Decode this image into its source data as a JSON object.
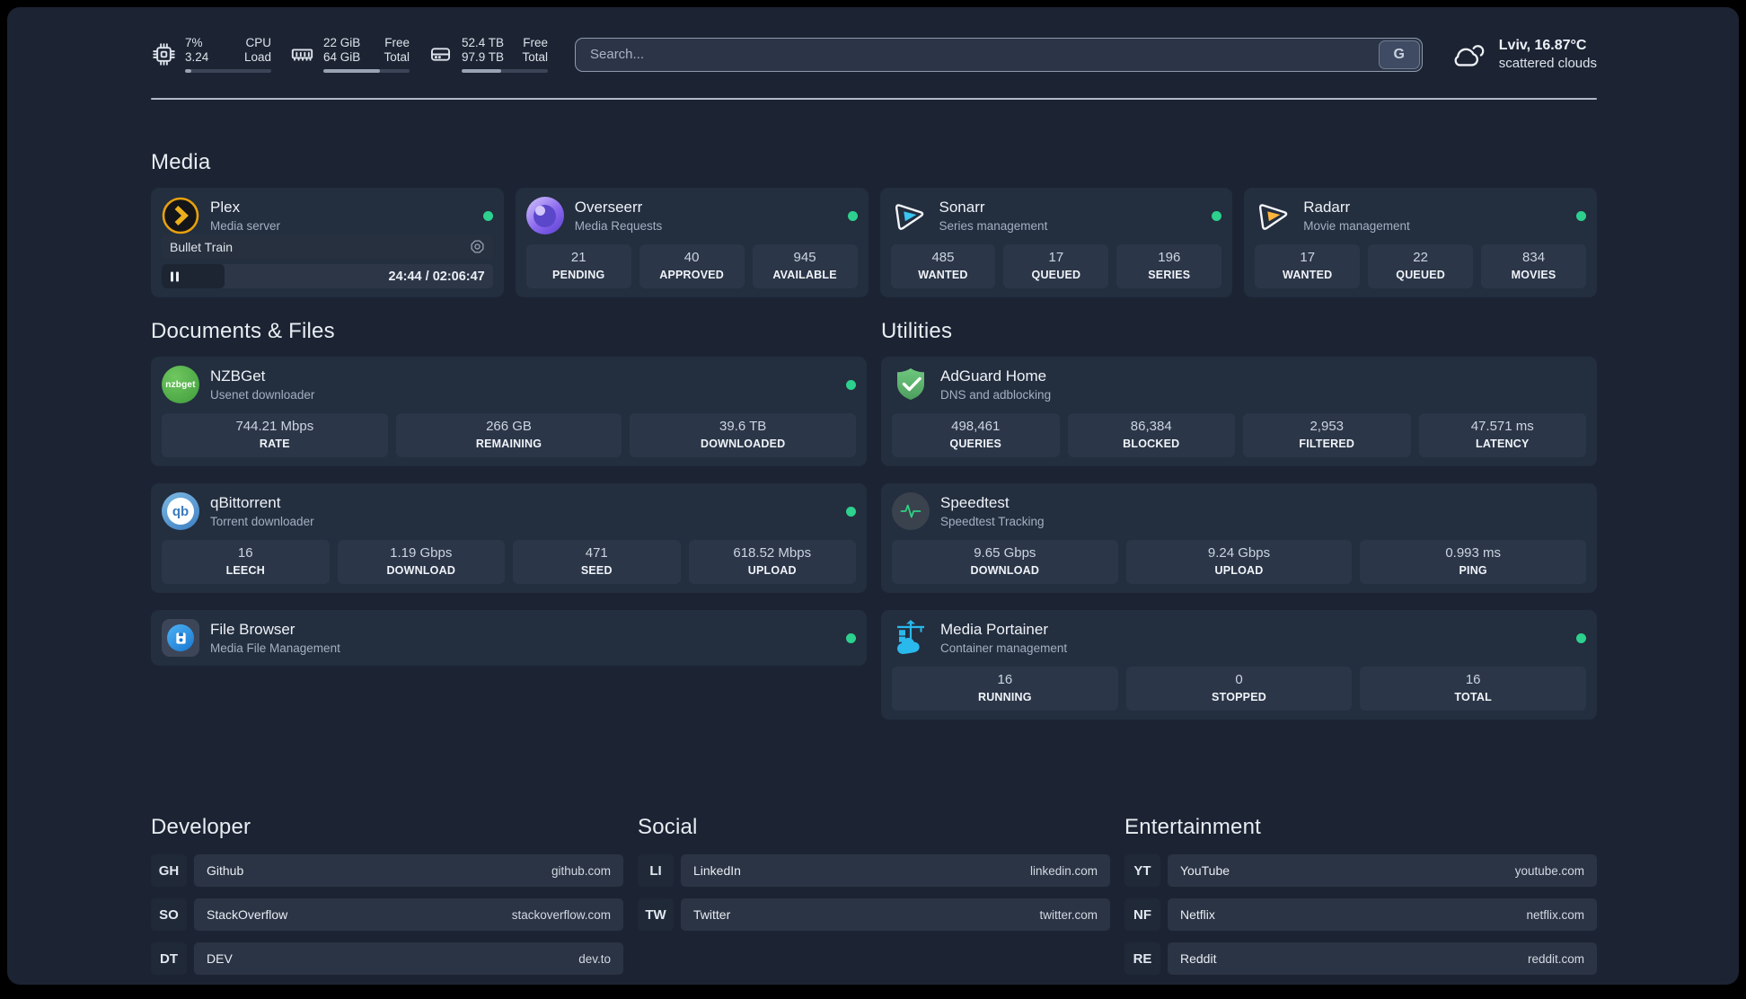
{
  "colors": {
    "page-bg": "#1c2433",
    "card-bg": "#232e3f",
    "tile-bg": "#2b3648",
    "green": "#2dd08d",
    "text": "#e8ecf2",
    "text-dim": "#a4b0c1",
    "divider": "#c2cbd6",
    "plex-orange": "#e7a00d",
    "overseerr-purple": "#8a68ee",
    "sonarr-blue": "#38c6f4",
    "radarr-orange": "#ffb53c",
    "nzbget-green": "#4caf50",
    "qbittorrent-blue": "#3d7fc4",
    "adguard-green": "#5fb86e",
    "speedtest-pulse": "#2ed184",
    "filebrowser-blue": "#2196f3",
    "portainer-blue": "#2ab9ec"
  },
  "header": {
    "resources": [
      {
        "icon": "cpu-icon",
        "values": [
          "7%",
          "3.24"
        ],
        "labels": [
          "CPU",
          "Load"
        ],
        "bar_pct": 7
      },
      {
        "icon": "memory-icon",
        "values": [
          "22 GiB",
          "64 GiB"
        ],
        "labels": [
          "Free",
          "Total"
        ],
        "bar_pct": 66
      },
      {
        "icon": "disk-icon",
        "values": [
          "52.4 TB",
          "97.9 TB"
        ],
        "labels": [
          "Free",
          "Total"
        ],
        "bar_pct": 46
      }
    ],
    "search": {
      "placeholder": "Search...",
      "provider_button": "G"
    },
    "weather": {
      "icon": "scattered-clouds-icon",
      "headline": "Lviv, 16.87°C",
      "condition": "scattered clouds"
    }
  },
  "media": {
    "title": "Media",
    "plex": {
      "name": "Plex",
      "description": "Media server",
      "online": true,
      "now_playing": "Bullet Train",
      "time_display": "24:44 / 02:06:47",
      "progress_pct": 19
    },
    "overseerr": {
      "name": "Overseerr",
      "description": "Media Requests",
      "online": true,
      "stats": [
        {
          "value": "21",
          "label": "PENDING"
        },
        {
          "value": "40",
          "label": "APPROVED"
        },
        {
          "value": "945",
          "label": "AVAILABLE"
        }
      ]
    },
    "sonarr": {
      "name": "Sonarr",
      "description": "Series management",
      "online": true,
      "stats": [
        {
          "value": "485",
          "label": "WANTED"
        },
        {
          "value": "17",
          "label": "QUEUED"
        },
        {
          "value": "196",
          "label": "SERIES"
        }
      ]
    },
    "radarr": {
      "name": "Radarr",
      "description": "Movie management",
      "online": true,
      "stats": [
        {
          "value": "17",
          "label": "WANTED"
        },
        {
          "value": "22",
          "label": "QUEUED"
        },
        {
          "value": "834",
          "label": "MOVIES"
        }
      ]
    }
  },
  "documents": {
    "title": "Documents & Files",
    "nzbget": {
      "name": "NZBGet",
      "description": "Usenet downloader",
      "online": true,
      "icon_text": "nzbget",
      "stats": [
        {
          "value": "744.21 Mbps",
          "label": "RATE"
        },
        {
          "value": "266 GB",
          "label": "REMAINING"
        },
        {
          "value": "39.6 TB",
          "label": "DOWNLOADED"
        }
      ]
    },
    "qbittorrent": {
      "name": "qBittorrent",
      "description": "Torrent downloader",
      "online": true,
      "icon_text": "qb",
      "stats": [
        {
          "value": "16",
          "label": "LEECH"
        },
        {
          "value": "1.19 Gbps",
          "label": "DOWNLOAD"
        },
        {
          "value": "471",
          "label": "SEED"
        },
        {
          "value": "618.52 Mbps",
          "label": "UPLOAD"
        }
      ]
    },
    "filebrowser": {
      "name": "File Browser",
      "description": "Media File Management",
      "online": true
    }
  },
  "utilities": {
    "title": "Utilities",
    "adguard": {
      "name": "AdGuard Home",
      "description": "DNS and adblocking",
      "stats": [
        {
          "value": "498,461",
          "label": "QUERIES"
        },
        {
          "value": "86,384",
          "label": "BLOCKED"
        },
        {
          "value": "2,953",
          "label": "FILTERED"
        },
        {
          "value": "47.571 ms",
          "label": "LATENCY"
        }
      ]
    },
    "speedtest": {
      "name": "Speedtest",
      "description": "Speedtest Tracking",
      "stats": [
        {
          "value": "9.65 Gbps",
          "label": "DOWNLOAD"
        },
        {
          "value": "9.24 Gbps",
          "label": "UPLOAD"
        },
        {
          "value": "0.993 ms",
          "label": "PING"
        }
      ]
    },
    "portainer": {
      "name": "Media Portainer",
      "description": "Container management",
      "online": true,
      "stats": [
        {
          "value": "16",
          "label": "RUNNING"
        },
        {
          "value": "0",
          "label": "STOPPED"
        },
        {
          "value": "16",
          "label": "TOTAL"
        }
      ]
    }
  },
  "bookmarks": {
    "developer": {
      "title": "Developer",
      "links": [
        {
          "abbr": "GH",
          "name": "Github",
          "url": "github.com"
        },
        {
          "abbr": "SO",
          "name": "StackOverflow",
          "url": "stackoverflow.com"
        },
        {
          "abbr": "DT",
          "name": "DEV",
          "url": "dev.to"
        }
      ]
    },
    "social": {
      "title": "Social",
      "links": [
        {
          "abbr": "LI",
          "name": "LinkedIn",
          "url": "linkedin.com"
        },
        {
          "abbr": "TW",
          "name": "Twitter",
          "url": "twitter.com"
        }
      ]
    },
    "entertainment": {
      "title": "Entertainment",
      "links": [
        {
          "abbr": "YT",
          "name": "YouTube",
          "url": "youtube.com"
        },
        {
          "abbr": "NF",
          "name": "Netflix",
          "url": "netflix.com"
        },
        {
          "abbr": "RE",
          "name": "Reddit",
          "url": "reddit.com"
        }
      ]
    }
  }
}
